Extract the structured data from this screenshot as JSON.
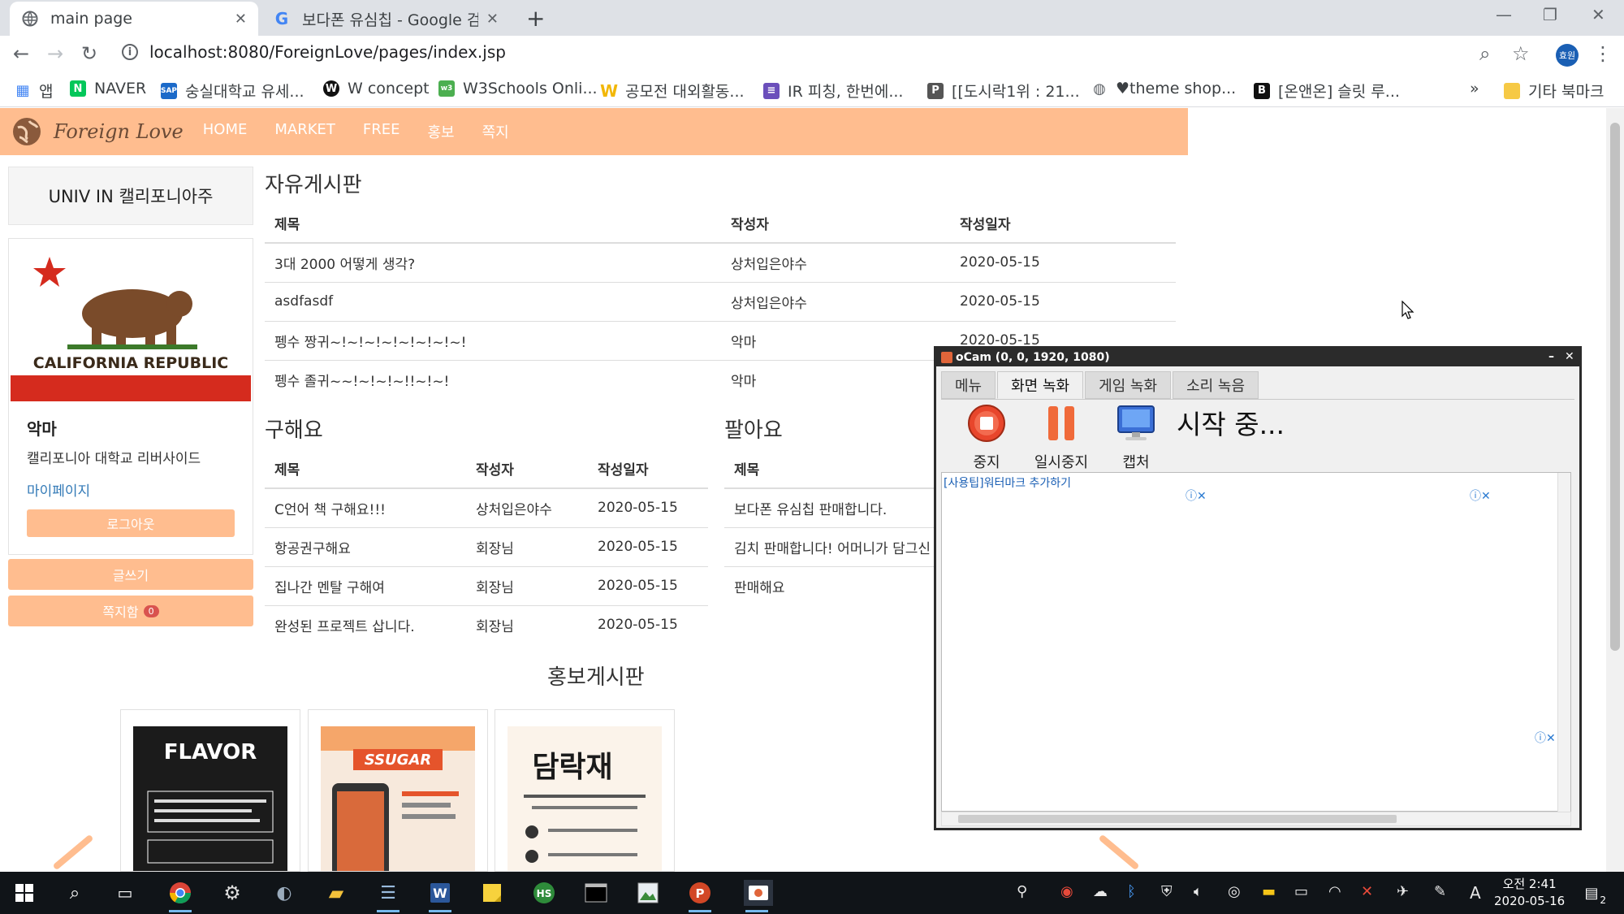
{
  "browser": {
    "tabs": [
      {
        "title": "main page",
        "active": true
      },
      {
        "title": "보다폰 유심칩 - Google 검",
        "active": false
      }
    ],
    "new_tab": "+",
    "url": "localhost:8080/ForeignLove/pages/index.jsp",
    "bookmarks": [
      {
        "label": "앱"
      },
      {
        "label": "NAVER"
      },
      {
        "label": "숭실대학교 유세..."
      },
      {
        "label": "W concept"
      },
      {
        "label": "W3Schools Onli..."
      },
      {
        "label": "공모전 대외활동..."
      },
      {
        "label": "IR 피칭, 한번에..."
      },
      {
        "label": "[[도시락1위 : 21..."
      },
      {
        "label": "♥theme shop..."
      },
      {
        "label": "[온앤온] 슬릿 루..."
      },
      {
        "label": "»"
      },
      {
        "label": "기타 북마크"
      }
    ],
    "profile_initials": "효원"
  },
  "site": {
    "brand": "Foreign Love",
    "menu": [
      "HOME",
      "MARKET",
      "FREE",
      "홍보",
      "쪽지"
    ],
    "univ": "UNIV IN 캘리포니아주",
    "flag_text": "CALIFORNIA REPUBLIC",
    "user": {
      "name": "악마",
      "school": "캘리포니아 대학교 리버사이드",
      "mypage": "마이페이지",
      "logout": "로그아웃"
    },
    "write_button": "글쓰기",
    "message_button": "쪽지함",
    "message_count": "0",
    "free_board": {
      "title": "자유게시판",
      "headers": [
        "제목",
        "작성자",
        "작성일자"
      ],
      "rows": [
        [
          "3대 2000 어떻게 생각?",
          "상처입은야수",
          "2020-05-15"
        ],
        [
          "asdfasdf",
          "상처입은야수",
          "2020-05-15"
        ],
        [
          "펭수 짱귀~!~!~!~!~!~!~!~!",
          "악마",
          "2020-05-15"
        ],
        [
          "펭수 졸귀~~!~!~!~!!~!~!",
          "악마",
          ""
        ]
      ]
    },
    "buy_board": {
      "title": "구해요",
      "headers": [
        "제목",
        "작성자",
        "작성일자"
      ],
      "rows": [
        [
          "C언어 책 구해요!!!",
          "상처입은야수",
          "2020-05-15"
        ],
        [
          "항공권구해요",
          "회장님",
          "2020-05-15"
        ],
        [
          "집나간 멘탈 구해여",
          "회장님",
          "2020-05-15"
        ],
        [
          "완성된 프로젝트 삽니다.",
          "회장님",
          "2020-05-15"
        ]
      ]
    },
    "sell_board": {
      "title": "팔아요",
      "headers": [
        "제목"
      ],
      "rows": [
        [
          "보다폰 유심칩 판매합니다."
        ],
        [
          "김치 판매합니다! 어머니가 담그신"
        ],
        [
          "판매해요"
        ]
      ]
    },
    "promo": {
      "title": "홍보게시판",
      "posters": [
        {
          "label": "FLAVOR"
        },
        {
          "label": "SSUGAR"
        },
        {
          "label": "담락재"
        }
      ]
    }
  },
  "ocam": {
    "title": "oCam (0, 0, 1920, 1080)",
    "tabs": [
      "메뉴",
      "화면 녹화",
      "게임 녹화",
      "소리 녹음"
    ],
    "tools": [
      {
        "label": "중지",
        "icon": "stop-icon"
      },
      {
        "label": "일시중지",
        "icon": "pause-icon"
      },
      {
        "label": "캡처",
        "icon": "monitor-icon"
      }
    ],
    "status": "시작 중...",
    "tip_link": "[사용팁]워터마크 추가하기"
  },
  "taskbar": {
    "time": "오전 2:41",
    "date": "2020-05-16",
    "ime": "A",
    "notifications": "2"
  },
  "colors": {
    "accent": "#ffbd8f",
    "link": "#337ab7",
    "taskbar": "#101418",
    "badge": "#d9534f"
  }
}
